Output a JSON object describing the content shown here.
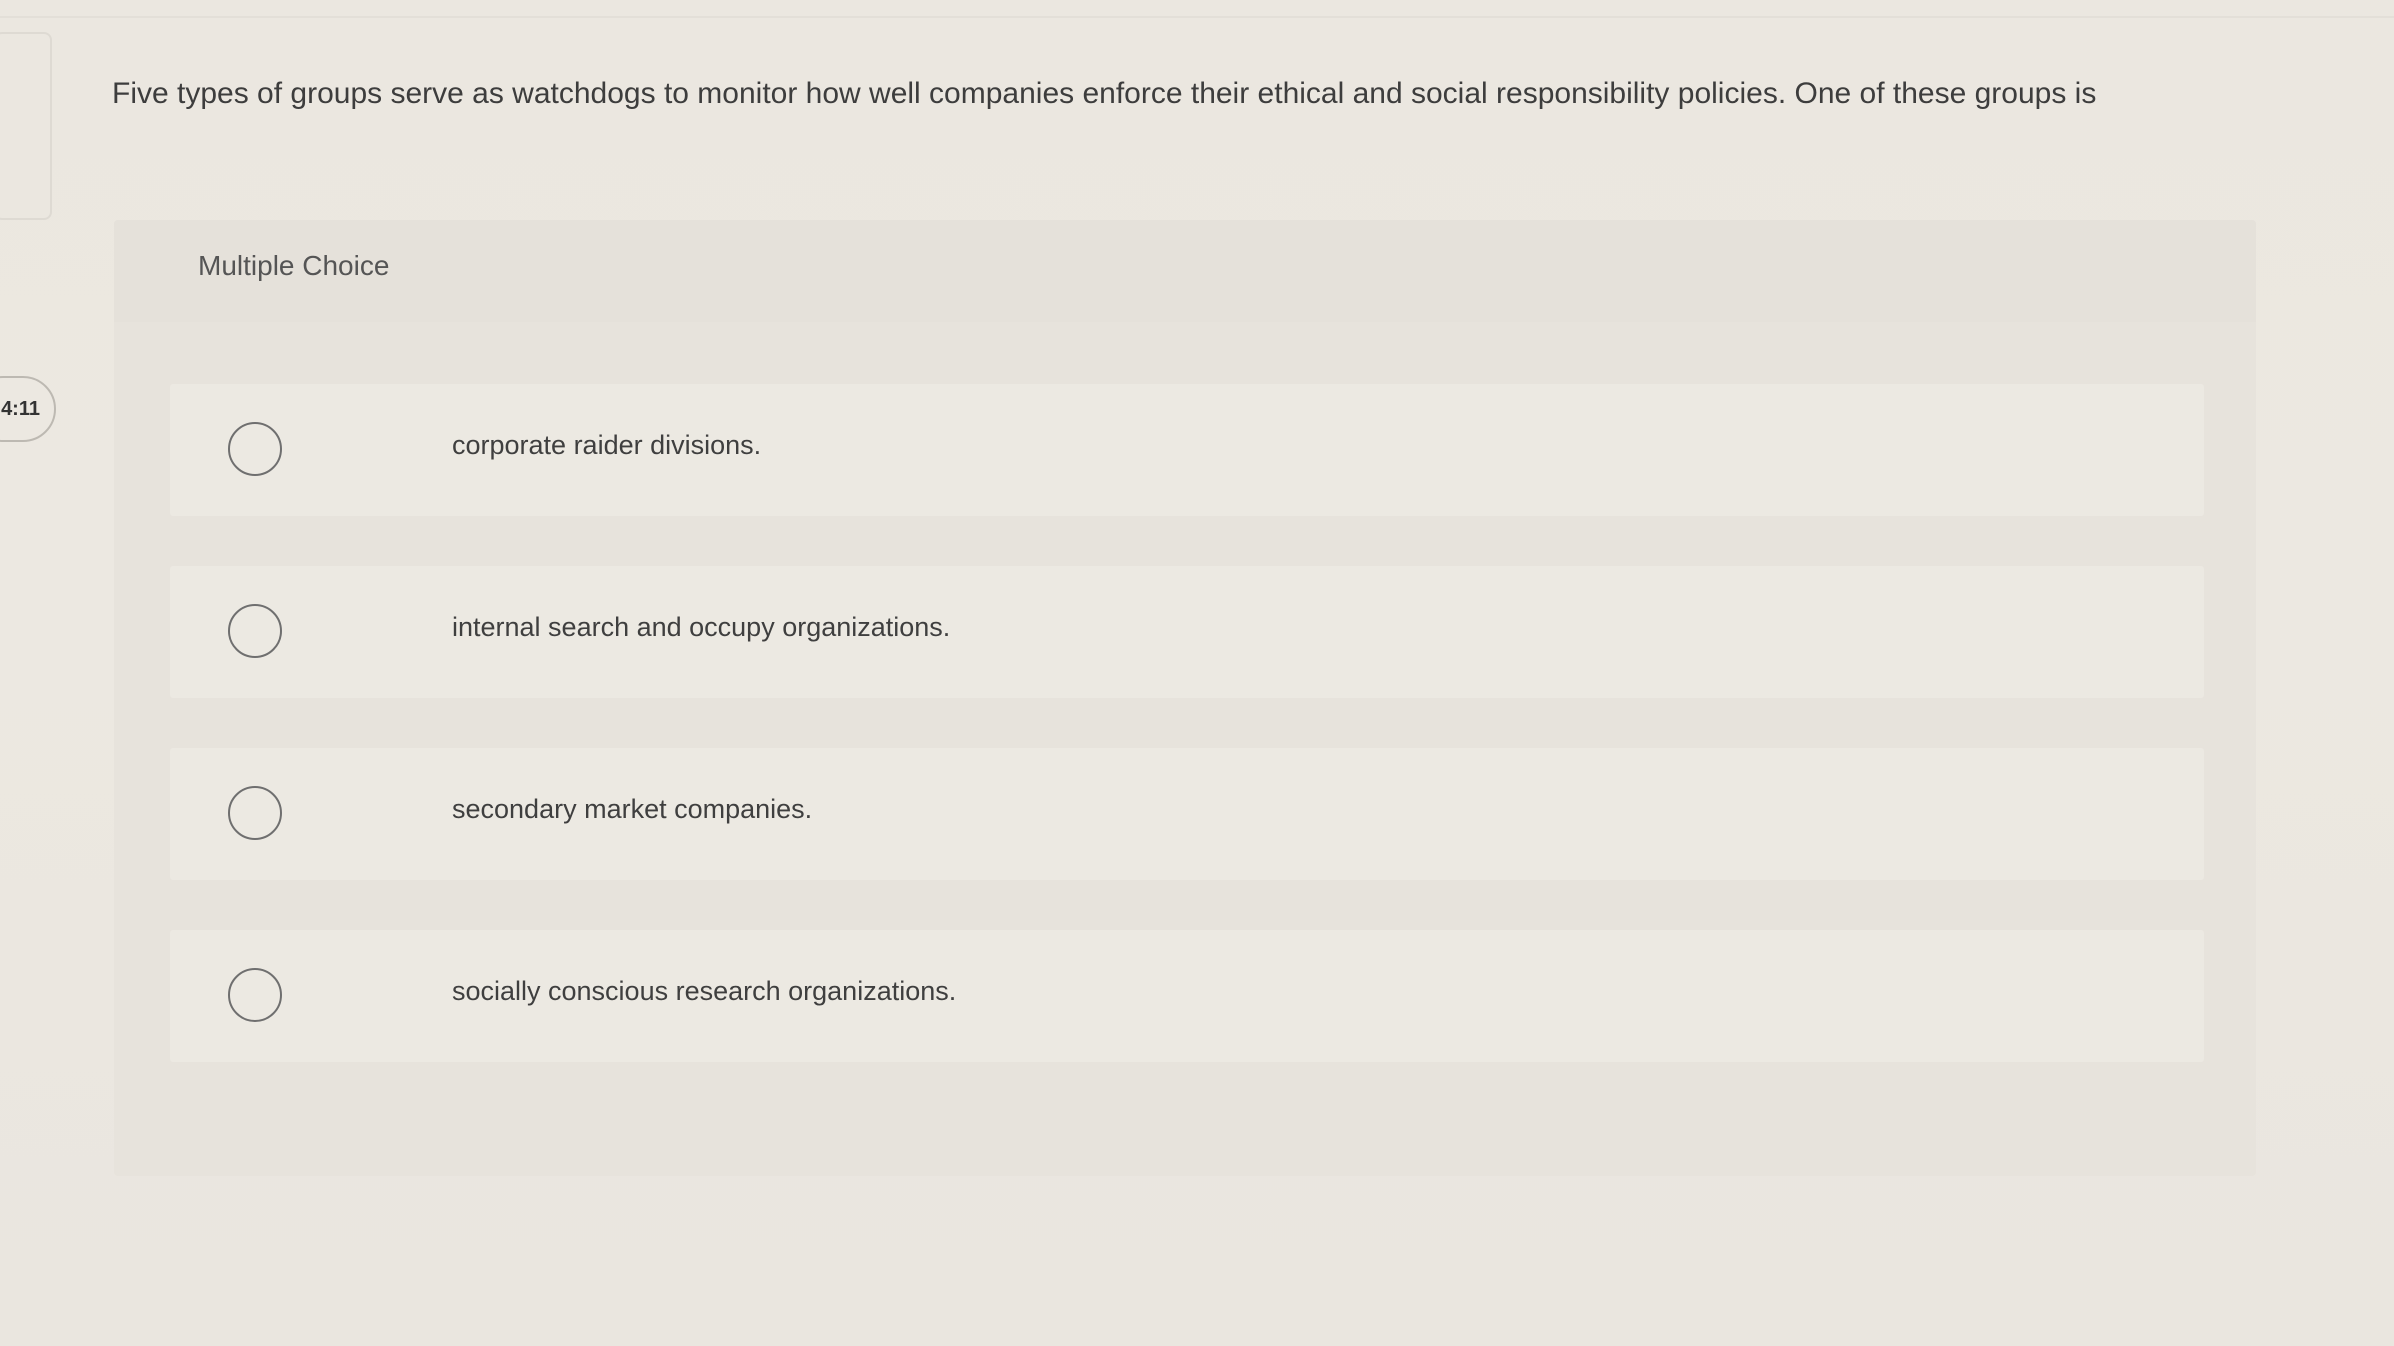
{
  "timer": {
    "text": "4:11"
  },
  "question": {
    "text": "Five types of groups serve as watchdogs to monitor how well companies enforce their ethical and social responsibility policies. One of these groups is"
  },
  "answer_panel": {
    "type_label": "Multiple Choice",
    "options": [
      {
        "text": "corporate raider divisions.",
        "selected": false
      },
      {
        "text": "internal search and occupy organizations.",
        "selected": false
      },
      {
        "text": "secondary market companies.",
        "selected": false
      },
      {
        "text": "socially conscious research organizations.",
        "selected": false
      }
    ]
  }
}
